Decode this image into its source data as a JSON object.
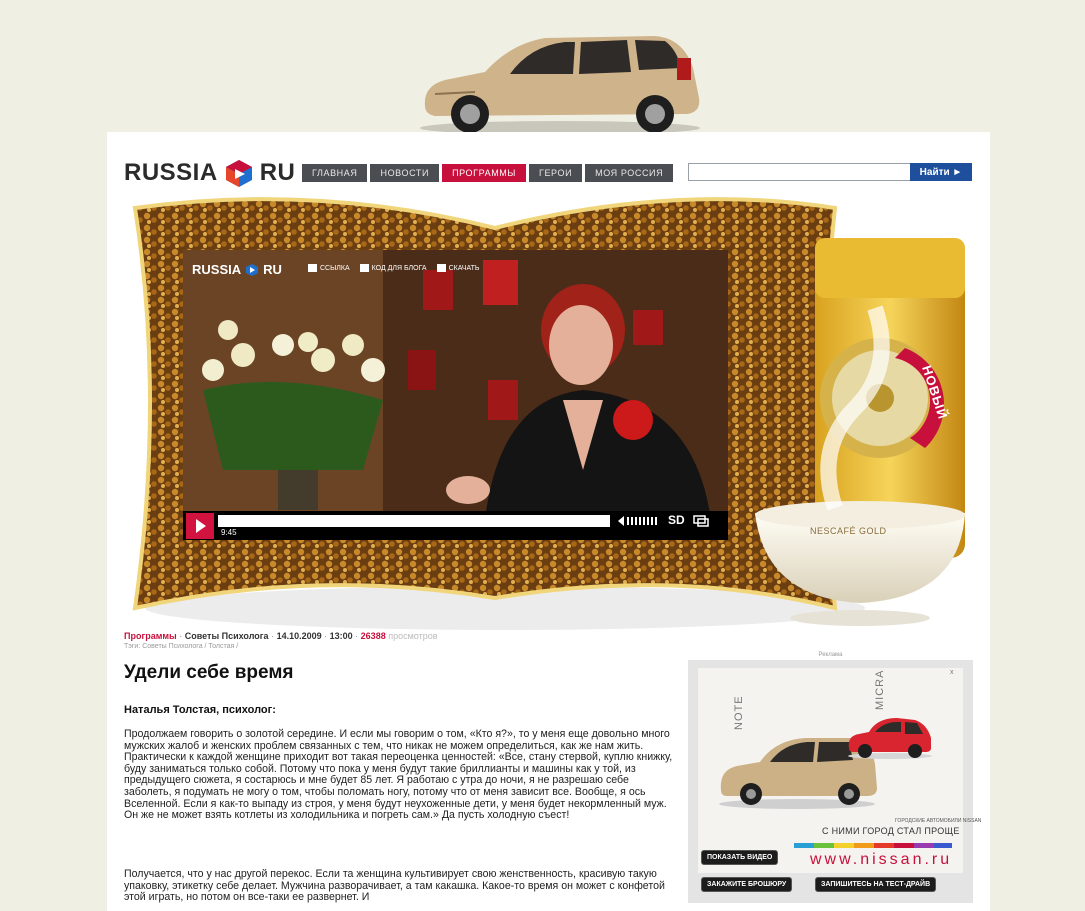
{
  "site": {
    "logo_left": "RUSSIA",
    "logo_right": "RU"
  },
  "nav": {
    "items": [
      {
        "label": "ГЛАВНАЯ",
        "active": false
      },
      {
        "label": "НОВОСТИ",
        "active": false
      },
      {
        "label": "ПРОГРАММЫ",
        "active": true
      },
      {
        "label": "ГЕРОИ",
        "active": false
      },
      {
        "label": "МОЯ РОССИЯ",
        "active": false
      }
    ]
  },
  "search": {
    "value": "",
    "button_label": "Найти ►"
  },
  "player": {
    "logo_left": "RUSSIA",
    "logo_right": "RU",
    "tools": [
      "ССЫЛКА",
      "КОД ДЛЯ БЛОГА",
      "СКАЧАТЬ"
    ],
    "time": "9:45",
    "quality": "SD",
    "progress": 0
  },
  "promo": {
    "badge": "НОВЫЙ",
    "product_label": "NESCAFÉ GOLD"
  },
  "meta": {
    "section": "Программы",
    "program": "Советы Психолога",
    "date": "14.10.2009",
    "time": "13:00",
    "views": "26388",
    "views_label": "просмотров",
    "tags": "Тэги: Советы Психолога / Толстая /"
  },
  "article": {
    "title": "Удели себе время",
    "author": "Наталья Толстая, психолог:",
    "paragraph_1": "Продолжаем говорить о золотой середине. И если мы говорим о том, «Кто я?», то у меня еще довольно много мужских жалоб и женских проблем связанных с тем, что никак не можем определиться, как же нам жить. Практически к каждой женщине приходит вот такая переоценка ценностей: «Все, стану стервой, куплю книжку, буду заниматься только собой. Потому что пока у меня будут такие бриллианты и машины как у той, из предыдущего сюжета, я состарюсь и мне будет 85 лет. Я работаю с утра до ночи, я не разрешаю себе заболеть, я подумать не могу о том, чтобы поломать ногу, потому что от меня зависит все. Вообще, я ось Вселенной. Если я как-то выпаду из строя, у меня будут неухоженные дети, у меня будет некормленный муж. Он же не может взять котлеты из холодильника и погреть сам.» Да пусть холодную съест!",
    "paragraph_2": "Получается, что у нас другой перекос. Если та женщина культивирует свою женственность, красивую такую упаковку, этикетку себе делает. Мужчина разворачивает, а там какашка. Какое-то время он может с конфетой этой играть, но потом он все-таки ее развернет. И"
  },
  "ad": {
    "label": "Реклама",
    "model_1": "NOTE",
    "model_2": "MICRA",
    "slogan_small": "ГОРОДСКИЕ АВТОМОБИЛИ NISSAN",
    "slogan": "С НИМИ ГОРОД СТАЛ ПРОЩЕ",
    "url": "www.nissan.ru",
    "video_button": "ПОКАЗАТЬ ВИДЕО",
    "brochure_button": "ЗАКАЖИТЕ БРОШЮРУ",
    "testdrive_button": "ЗАПИШИТЕСЬ НА ТЕСТ-ДРАЙВ",
    "close": "x"
  },
  "colors": {
    "brand_red": "#c8103c",
    "nav_bg": "#4a4d52",
    "search_button": "#1d4f9c",
    "page_bg": "#efefe4"
  }
}
